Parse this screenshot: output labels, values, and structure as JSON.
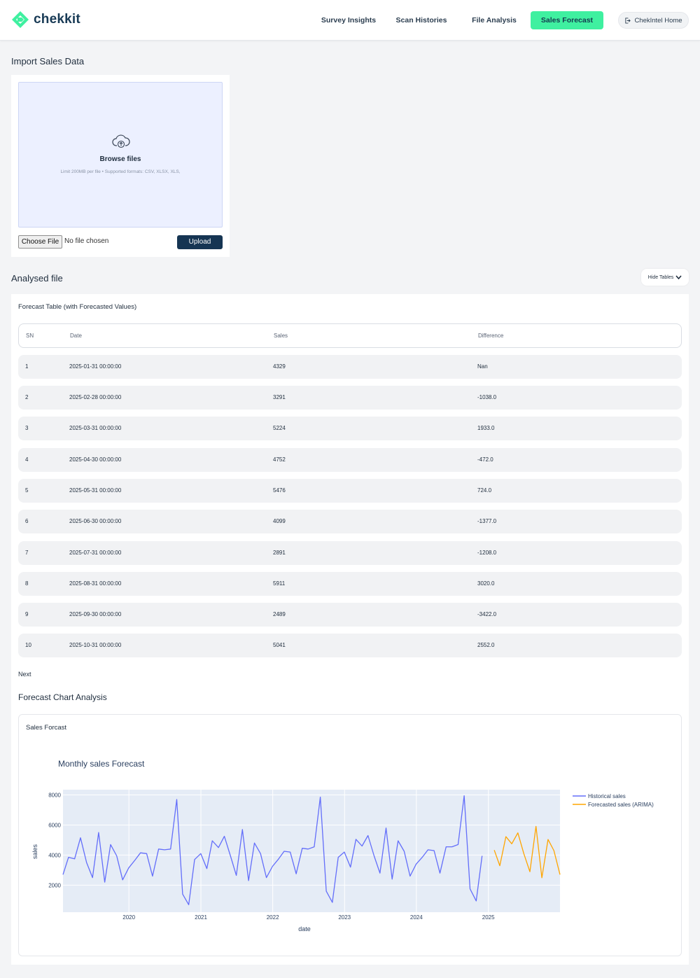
{
  "brand": {
    "name": "chekkit"
  },
  "nav": {
    "links": [
      "Survey Insights",
      "Scan Histories",
      "File Analysis",
      "Sales Forecast"
    ],
    "active": "Sales Forecast",
    "home_label": "ChekIntel Home"
  },
  "import": {
    "title": "Import Sales Data",
    "browse_label": "Browse files",
    "limit_text": "Limit 200MB per file • Supported formats: CSV, XLSX, XLS,",
    "choose_label": "Choose File",
    "no_file_text": "No file chosen",
    "upload_label": "Upload"
  },
  "analysed": {
    "title": "Analysed file",
    "hide_tables_label": "Hide Tables",
    "table_title": "Forecast Table (with Forecasted Values)",
    "columns": [
      "SN",
      "Date",
      "Sales",
      "Difference"
    ],
    "rows": [
      [
        "1",
        "2025-01-31 00:00:00",
        "4329",
        "Nan"
      ],
      [
        "2",
        "2025-02-28 00:00:00",
        "3291",
        "-1038.0"
      ],
      [
        "3",
        "2025-03-31 00:00:00",
        "5224",
        "1933.0"
      ],
      [
        "4",
        "2025-04-30 00:00:00",
        "4752",
        "-472.0"
      ],
      [
        "5",
        "2025-05-31 00:00:00",
        "5476",
        "724.0"
      ],
      [
        "6",
        "2025-06-30 00:00:00",
        "4099",
        "-1377.0"
      ],
      [
        "7",
        "2025-07-31 00:00:00",
        "2891",
        "-1208.0"
      ],
      [
        "8",
        "2025-08-31 00:00:00",
        "5911",
        "3020.0"
      ],
      [
        "9",
        "2025-09-30 00:00:00",
        "2489",
        "-3422.0"
      ],
      [
        "10",
        "2025-10-31 00:00:00",
        "5041",
        "2552.0"
      ]
    ],
    "next_label": "Next",
    "chart_heading": "Forecast Chart Analysis",
    "chart_card_title": "Sales Forcast"
  },
  "colors": {
    "accent": "#3ff0a0",
    "primary": "#163553",
    "historical": "#636efa",
    "forecast": "#ffa500",
    "plot_bg": "#e5ecf6"
  },
  "chart_data": {
    "type": "line",
    "title": "Monthly sales Forecast",
    "xlabel": "date",
    "ylabel": "sales",
    "x_ticks": [
      "2020",
      "2021",
      "2022",
      "2023",
      "2024",
      "2025"
    ],
    "y_ticks": [
      2000,
      4000,
      6000,
      8000
    ],
    "xlim": [
      "2019-01-31",
      "2025-12-31"
    ],
    "ylim": [
      200,
      8350
    ],
    "grid": true,
    "legend_position": "right",
    "series": [
      {
        "name": "Historical sales",
        "start": "2019-01-31",
        "values": [
          2700,
          3850,
          3750,
          5150,
          3500,
          2500,
          5500,
          2200,
          4700,
          3950,
          2350,
          3150,
          3650,
          4150,
          4100,
          2600,
          4400,
          4350,
          4400,
          7700,
          1400,
          700,
          3700,
          4100,
          3100,
          4950,
          4500,
          5250,
          3950,
          2650,
          5700,
          2300,
          4800,
          4100,
          2500,
          3250,
          3750,
          4250,
          4200,
          2750,
          4450,
          4400,
          4550,
          7850,
          1600,
          850,
          3850,
          4200,
          3200,
          5050,
          4600,
          5300,
          3950,
          2800,
          5800,
          2400,
          4950,
          4250,
          2600,
          3400,
          3850,
          4350,
          4300,
          2800,
          4550,
          4550,
          4700,
          7950,
          1750,
          950,
          3950
        ]
      },
      {
        "name": "Forecasted sales (ARIMA)",
        "start": "2025-01-31",
        "values": [
          4329,
          3291,
          5224,
          4752,
          5476,
          4099,
          2891,
          5911,
          2489,
          5041,
          4300,
          2700
        ]
      }
    ]
  }
}
